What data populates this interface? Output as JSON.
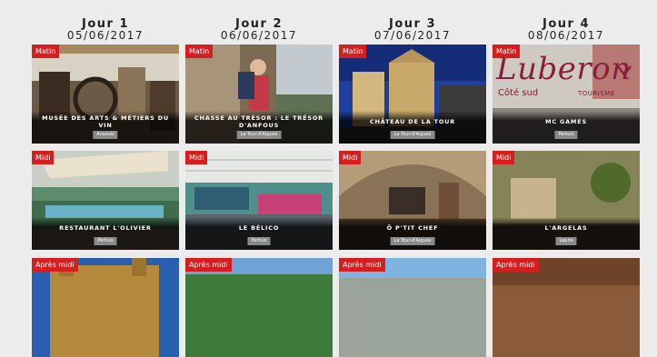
{
  "days": [
    {
      "name": "Jour 1",
      "date": "05/06/2017",
      "cards": [
        {
          "tag": "Matin",
          "title": "MUSÉE DES ARTS & MÉTIERS DU VIN",
          "location": "Ansouis"
        },
        {
          "tag": "Midi",
          "title": "RESTAURANT L'OLIVIER",
          "location": "Pertuis"
        },
        {
          "tag": "Après midi",
          "title": "",
          "location": ""
        }
      ]
    },
    {
      "name": "Jour 2",
      "date": "06/06/2017",
      "cards": [
        {
          "tag": "Matin",
          "title": "CHASSE AU TRÉSOR : LE TRÉSOR D'ANFOUS",
          "location": "La Tour-d'Aigues"
        },
        {
          "tag": "Midi",
          "title": "LE BÉLICO",
          "location": "Pertuis"
        },
        {
          "tag": "Après midi",
          "title": "",
          "location": ""
        }
      ]
    },
    {
      "name": "Jour 3",
      "date": "07/06/2017",
      "cards": [
        {
          "tag": "Matin",
          "title": "CHÂTEAU DE LA TOUR",
          "location": "La Tour-d'Aigues"
        },
        {
          "tag": "Midi",
          "title": "Ô P'TIT CHEF",
          "location": "La Tour-d'Aigues"
        },
        {
          "tag": "Après midi",
          "title": "",
          "location": ""
        }
      ]
    },
    {
      "name": "Jour 4",
      "date": "08/06/2017",
      "cards": [
        {
          "tag": "Matin",
          "title": "MC GAMES",
          "location": "Pertuis",
          "logo": {
            "text": "Luberon",
            "sub_left": "Côté sud",
            "sub_right": "TOURISME"
          }
        },
        {
          "tag": "Midi",
          "title": "L'ARGELAS",
          "location": "Lauris"
        },
        {
          "tag": "Après midi",
          "title": "",
          "location": ""
        }
      ]
    }
  ],
  "colors": {
    "tag": "#d61e1e",
    "background": "#ececec",
    "location_badge": "#8a8a8a"
  }
}
